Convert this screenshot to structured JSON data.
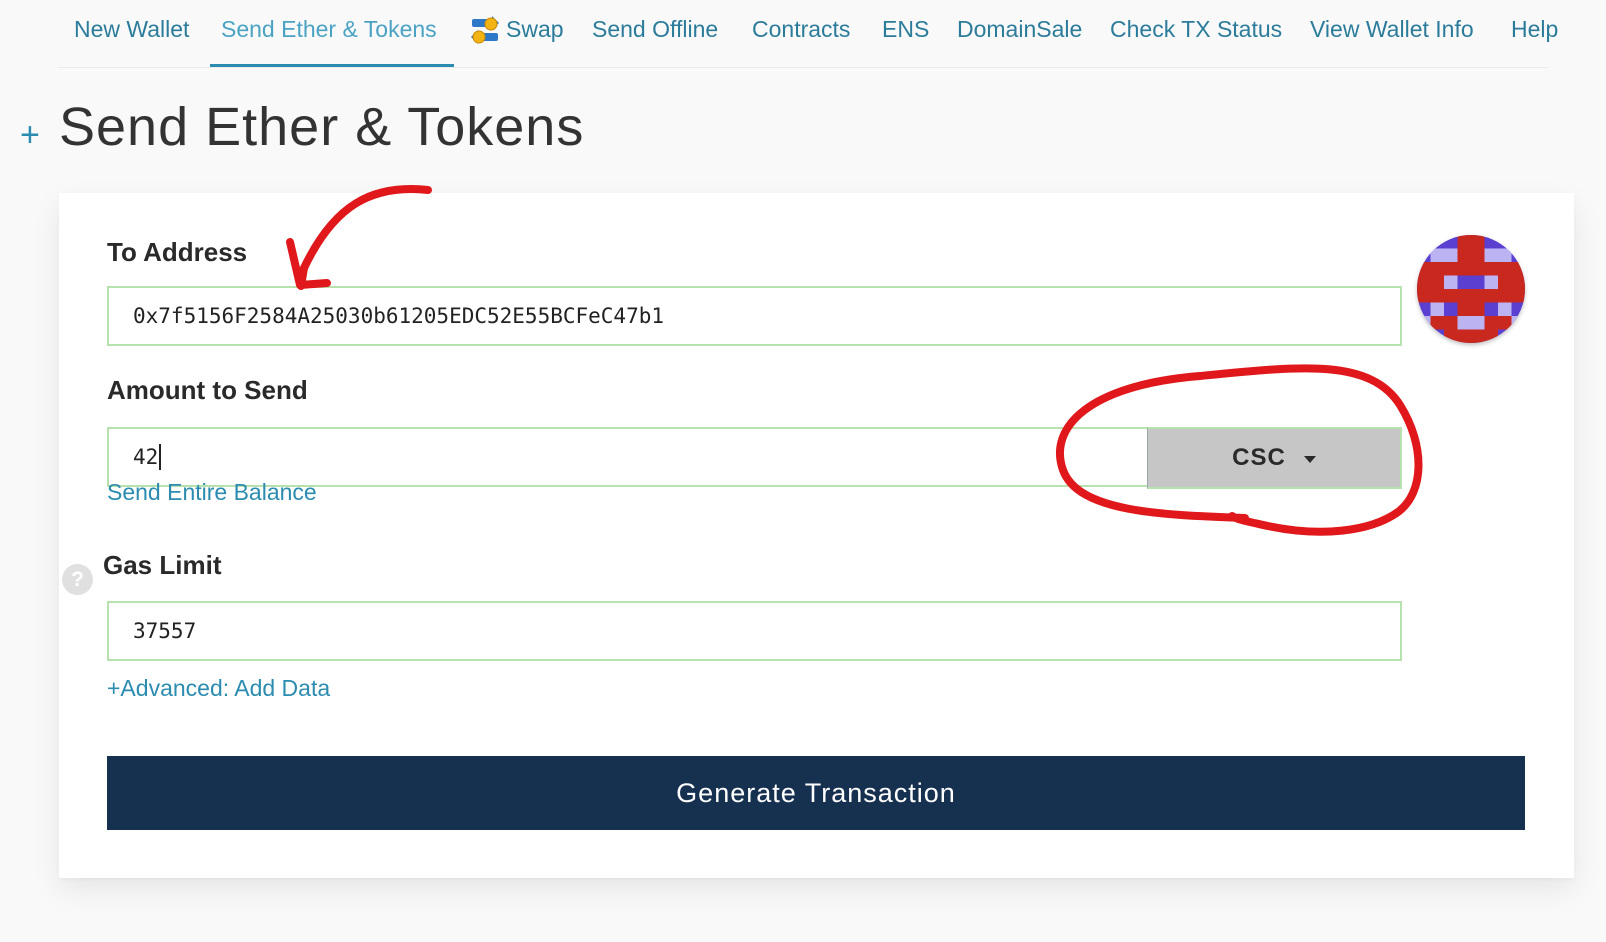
{
  "nav": {
    "items": [
      {
        "label": "New Wallet"
      },
      {
        "label": "Send Ether & Tokens"
      },
      {
        "label": "Swap"
      },
      {
        "label": "Send Offline"
      },
      {
        "label": "Contracts"
      },
      {
        "label": "ENS"
      },
      {
        "label": "DomainSale"
      },
      {
        "label": "Check TX Status"
      },
      {
        "label": "View Wallet Info"
      },
      {
        "label": "Help"
      }
    ],
    "active_index": 1,
    "swap_icon": "swap-arrows-icon"
  },
  "heading": {
    "expand_symbol": "+",
    "title": "Send Ether & Tokens"
  },
  "form": {
    "to_address": {
      "label": "To Address",
      "value": "0x7f5156F2584A25030b61205EDC52E55BCFeC47b1"
    },
    "amount": {
      "label": "Amount to Send",
      "value": "42",
      "token": "CSC",
      "send_entire_balance": "Send Entire Balance"
    },
    "gas_limit": {
      "label": "Gas Limit",
      "help_symbol": "?",
      "value": "37557"
    },
    "advanced_link": "+Advanced: Add Data",
    "generate_button": "Generate Transaction"
  },
  "colors": {
    "link": "#2b8cb0",
    "field_border_valid": "#b7e1ad",
    "primary_button": "#163050",
    "token_button": "#c6c6c6",
    "annotation": "#e0181c",
    "identicon_blue": "#5a3fd0",
    "identicon_red": "#c8281e",
    "identicon_light": "#bcb4f2"
  },
  "annotations": [
    "red-arrow-pointing-to-address",
    "red-circle-around-token-selector"
  ]
}
